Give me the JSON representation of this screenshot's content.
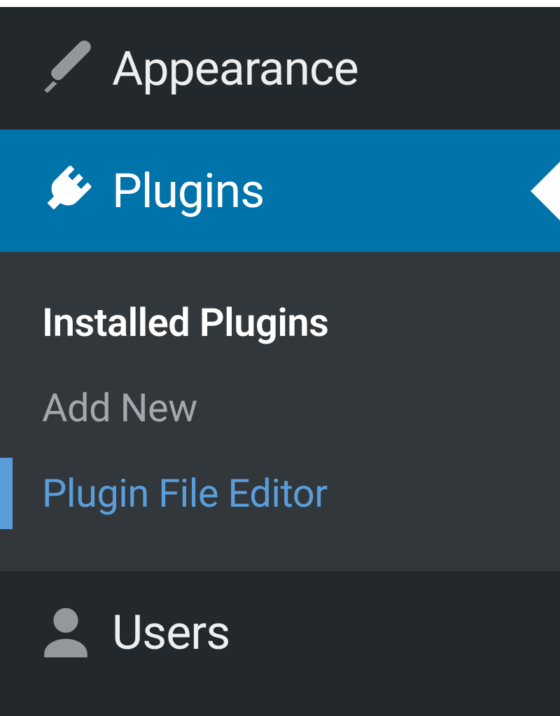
{
  "sidebar": {
    "appearance": {
      "label": "Appearance"
    },
    "plugins": {
      "label": "Plugins"
    },
    "users": {
      "label": "Users"
    },
    "submenu": {
      "installed": "Installed Plugins",
      "add_new": "Add New",
      "file_editor": "Plugin File Editor"
    }
  }
}
